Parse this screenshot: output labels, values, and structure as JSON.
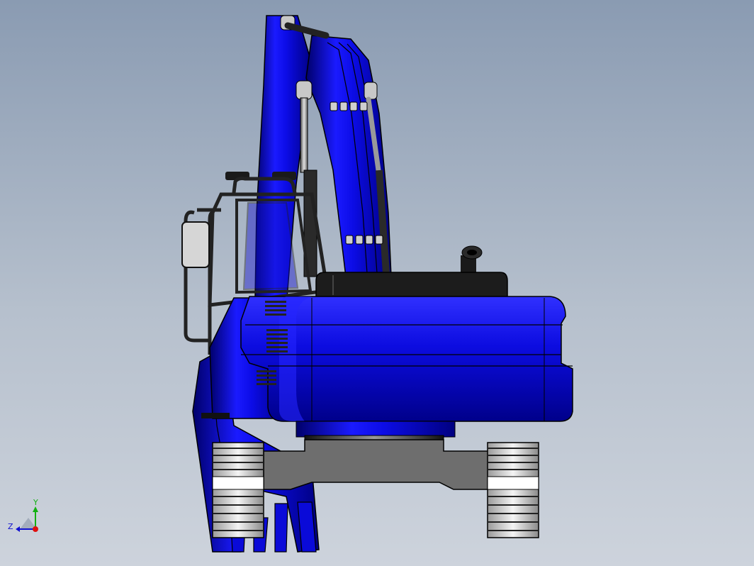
{
  "viewport": {
    "background_top": "#8a9bb2",
    "background_bottom": "#cdd3dc"
  },
  "model": {
    "body_color": "#0a0ad8",
    "body_dark": "#000088",
    "engine_cover_color": "#1c1c1c",
    "undercarriage_color": "#6e6e6e",
    "cylinder_rod_color": "#b4b4b4",
    "track_color": "#d8d8d8"
  },
  "triad": {
    "x_color": "#e01010",
    "y_color": "#12b012",
    "z_color": "#1010d0",
    "y_label": "Y",
    "z_label": "Z"
  }
}
